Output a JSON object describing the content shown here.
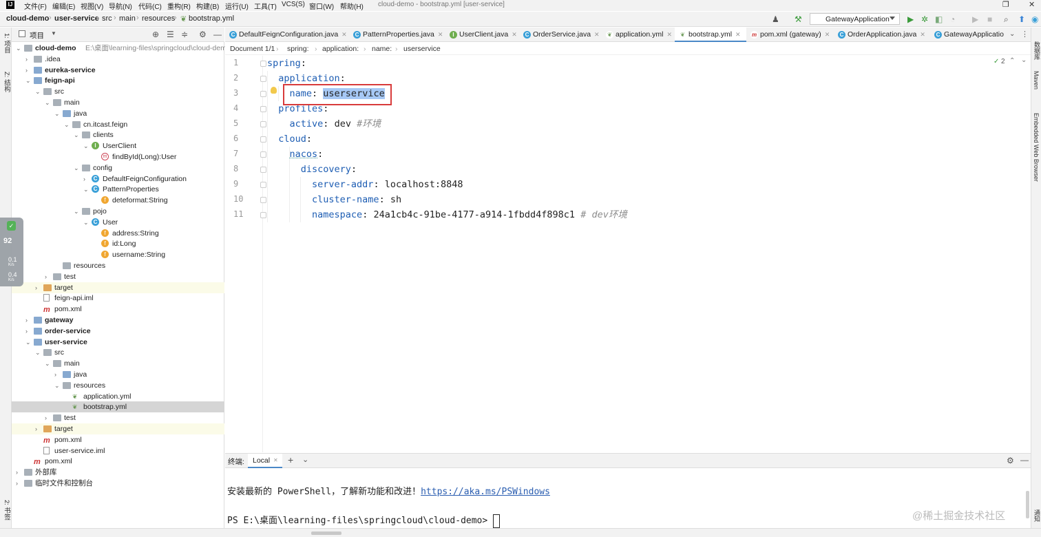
{
  "menubar": {
    "logo": "IJ",
    "items": [
      "文件(F)",
      "编辑(E)",
      "视图(V)",
      "导航(N)",
      "代码(C)",
      "重构(R)",
      "构建(B)",
      "运行(U)",
      "工具(T)",
      "VCS(S)",
      "窗口(W)",
      "帮助(H)"
    ],
    "window_title": "cloud-demo - bootstrap.yml [user-service]"
  },
  "navbar": {
    "crumbs": [
      "cloud-demo",
      "user-service",
      "src",
      "main",
      "resources",
      "bootstrap.yml"
    ],
    "run_config": "GatewayApplication"
  },
  "left_stripe": {
    "top_label": "1: 项目",
    "mid_label": "Z: 结构",
    "bottom_label": "2: 书签"
  },
  "project_panel": {
    "title": "项目",
    "tree": [
      {
        "label": "cloud-demo",
        "path": "E:\\桌面\\learning-files\\springcloud\\cloud-demo"
      },
      {
        "label": ".idea"
      },
      {
        "label": "eureka-service"
      },
      {
        "label": "feign-api"
      },
      {
        "label": "src"
      },
      {
        "label": "main"
      },
      {
        "label": "java"
      },
      {
        "label": "cn.itcast.feign"
      },
      {
        "label": "clients"
      },
      {
        "label": "UserClient"
      },
      {
        "label": "findById(Long):User"
      },
      {
        "label": "config"
      },
      {
        "label": "DefaultFeignConfiguration"
      },
      {
        "label": "PatternProperties"
      },
      {
        "label": "deteformat:String"
      },
      {
        "label": "pojo"
      },
      {
        "label": "User"
      },
      {
        "label": "address:String"
      },
      {
        "label": "id:Long"
      },
      {
        "label": "username:String"
      },
      {
        "label": "resources"
      },
      {
        "label": "test"
      },
      {
        "label": "target"
      },
      {
        "label": "feign-api.iml"
      },
      {
        "label": "pom.xml"
      },
      {
        "label": "gateway"
      },
      {
        "label": "order-service"
      },
      {
        "label": "user-service"
      },
      {
        "label": "src"
      },
      {
        "label": "main"
      },
      {
        "label": "java"
      },
      {
        "label": "resources"
      },
      {
        "label": "application.yml"
      },
      {
        "label": "bootstrap.yml"
      },
      {
        "label": "test"
      },
      {
        "label": "target"
      },
      {
        "label": "pom.xml"
      },
      {
        "label": "user-service.iml"
      },
      {
        "label": "pom.xml"
      },
      {
        "label": "外部库"
      },
      {
        "label": "临时文件和控制台"
      }
    ]
  },
  "net_widget": {
    "percent": "92",
    "up": "0.1",
    "up_unit": "K/s",
    "down": "0.4",
    "down_unit": "K/s"
  },
  "editor": {
    "tabs": [
      "DefaultFeignConfiguration.java",
      "PatternProperties.java",
      "UserClient.java",
      "OrderService.java",
      "application.yml",
      "bootstrap.yml",
      "pom.xml (gateway)",
      "OrderApplication.java",
      "GatewayApplicatio"
    ],
    "active_tab": "bootstrap.yml",
    "breadcrumb": [
      "Document 1/1",
      "spring:",
      "application:",
      "name:",
      "userservice"
    ],
    "inspection_count": "2",
    "lines": [
      {
        "n": "1",
        "key": "spring",
        "value": "",
        "comment": ""
      },
      {
        "n": "2",
        "key": "application",
        "value": "",
        "comment": ""
      },
      {
        "n": "3",
        "key": "name",
        "value": "userservice",
        "comment": ""
      },
      {
        "n": "4",
        "key": "profiles",
        "value": "",
        "comment": ""
      },
      {
        "n": "5",
        "key": "active",
        "value": "dev",
        "comment": "#环境"
      },
      {
        "n": "6",
        "key": "cloud",
        "value": "",
        "comment": ""
      },
      {
        "n": "7",
        "key": "nacos",
        "value": "",
        "comment": ""
      },
      {
        "n": "8",
        "key": "discovery",
        "value": "",
        "comment": ""
      },
      {
        "n": "9",
        "key": "server-addr",
        "value": "localhost:8848",
        "comment": ""
      },
      {
        "n": "10",
        "key": "cluster-name",
        "value": "sh",
        "comment": ""
      },
      {
        "n": "11",
        "key": "namespace",
        "value": "24a1cb4c-91be-4177-a914-1fbdd4f898c1",
        "comment": "# dev环境"
      }
    ]
  },
  "right_stripe": {
    "labels": [
      "数据库",
      "Maven",
      "Embedded Web Browser",
      "通知"
    ]
  },
  "terminal": {
    "title": "终端:",
    "tab": "Local",
    "line1_prefix": "安装最新的 PowerShell，了解新功能和改进！",
    "line1_link": "https://aka.ms/PSWindows",
    "prompt": "PS E:\\桌面\\learning-files\\springcloud\\cloud-demo> "
  },
  "watermark": "@稀土掘金技术社区",
  "colors": {
    "keyword": "#1d5db3",
    "selection": "#a6c8f5",
    "highlight_box": "#d83a3a",
    "active_tab_underline": "#4a88c7"
  }
}
